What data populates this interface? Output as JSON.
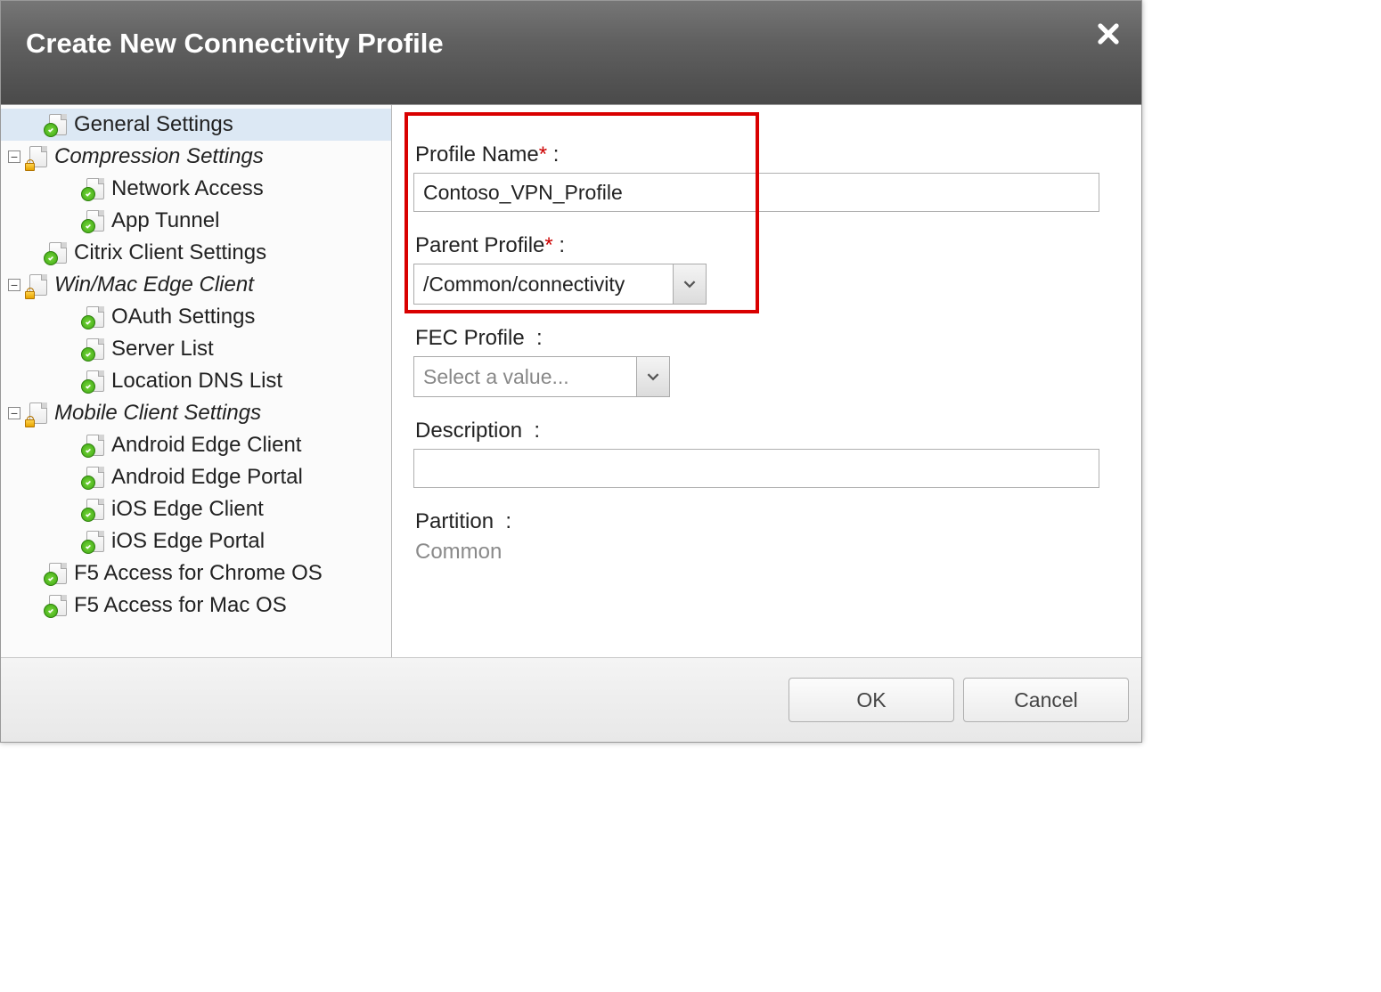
{
  "header": {
    "title": "Create New Connectivity Profile"
  },
  "sidebar": {
    "general_settings": "General Settings",
    "compression_settings": "Compression Settings",
    "network_access": "Network Access",
    "app_tunnel": "App Tunnel",
    "citrix_client_settings": "Citrix Client Settings",
    "win_mac_edge_client": "Win/Mac Edge Client",
    "oauth_settings": "OAuth Settings",
    "server_list": "Server List",
    "location_dns_list": "Location DNS List",
    "mobile_client_settings": "Mobile Client Settings",
    "android_edge_client": "Android Edge Client",
    "android_edge_portal": "Android Edge Portal",
    "ios_edge_client": "iOS Edge Client",
    "ios_edge_portal": "iOS Edge Portal",
    "f5_access_chrome": "F5 Access for Chrome OS",
    "f5_access_mac": "F5 Access for Mac OS"
  },
  "form": {
    "profile_name_label": "Profile Name",
    "profile_name_value": "Contoso_VPN_Profile",
    "parent_profile_label": "Parent Profile",
    "parent_profile_value": "/Common/connectivity",
    "fec_profile_label": "FEC Profile",
    "fec_profile_placeholder": "Select a value...",
    "description_label": "Description",
    "description_value": "",
    "partition_label": "Partition",
    "partition_value": "Common"
  },
  "footer": {
    "ok": "OK",
    "cancel": "Cancel"
  }
}
